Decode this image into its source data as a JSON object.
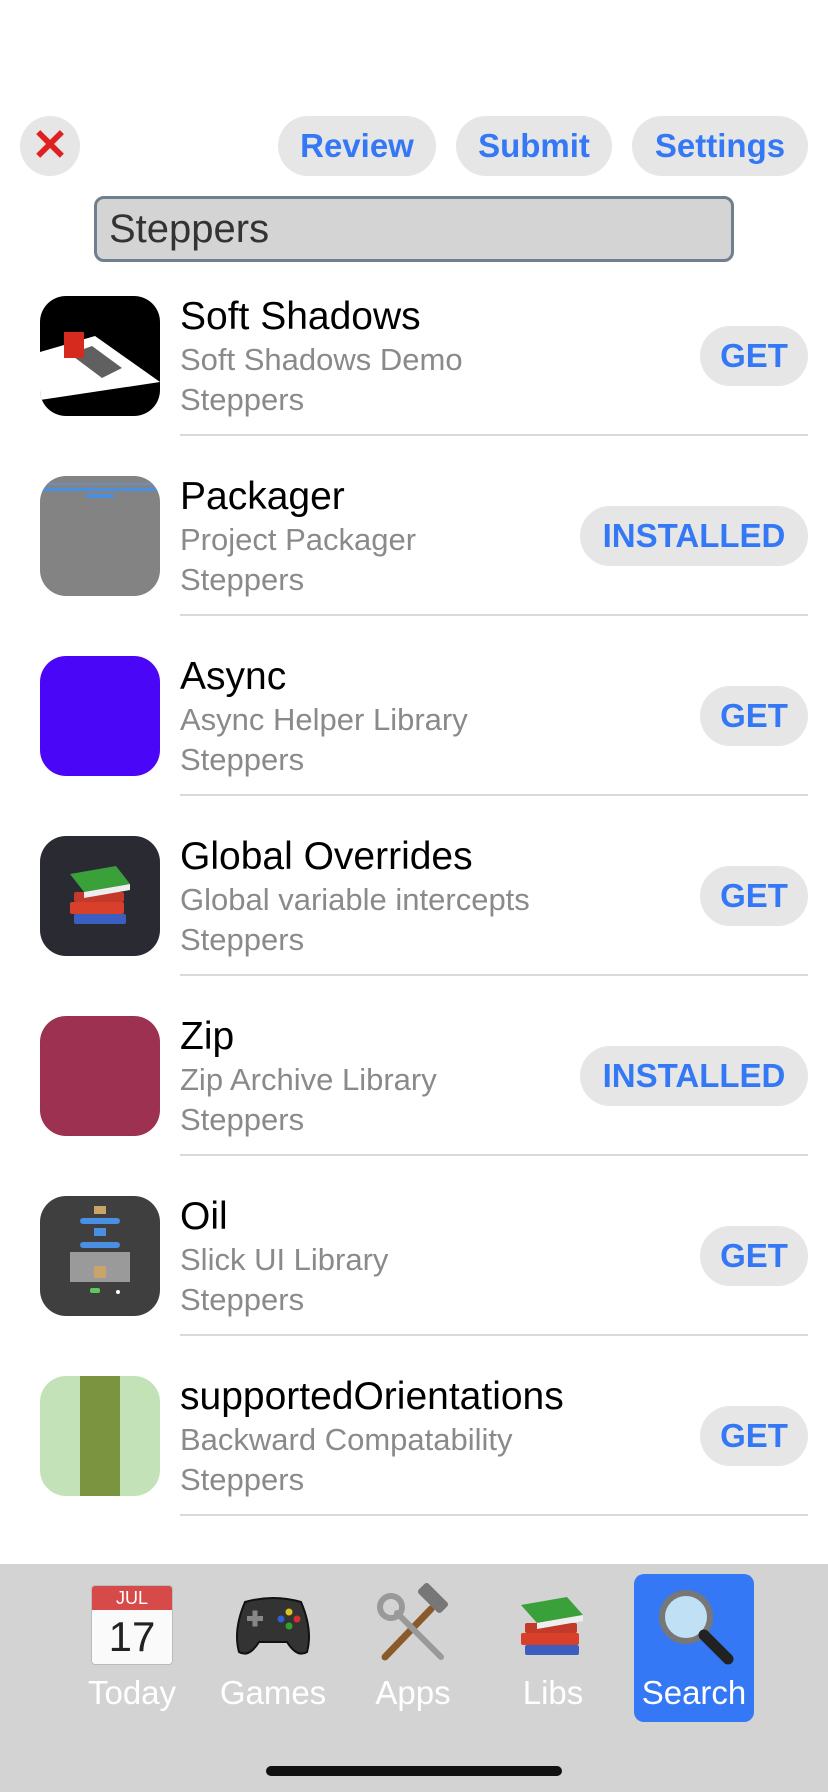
{
  "header": {
    "close_symbol": "✕",
    "review_label": "Review",
    "submit_label": "Submit",
    "settings_label": "Settings"
  },
  "search": {
    "value": "Steppers"
  },
  "apps": [
    {
      "name": "Soft Shadows",
      "description": "Soft Shadows Demo",
      "author": "Steppers",
      "action": "GET"
    },
    {
      "name": "Packager",
      "description": "Project Packager",
      "author": "Steppers",
      "action": "INSTALLED"
    },
    {
      "name": "Async",
      "description": "Async Helper Library",
      "author": "Steppers",
      "action": "GET"
    },
    {
      "name": "Global Overrides",
      "description": "Global variable intercepts",
      "author": "Steppers",
      "action": "GET"
    },
    {
      "name": "Zip",
      "description": "Zip Archive Library",
      "author": "Steppers",
      "action": "INSTALLED"
    },
    {
      "name": "Oil",
      "description": "Slick UI Library",
      "author": "Steppers",
      "action": "GET"
    },
    {
      "name": "supportedOrientations",
      "description": "Backward Compatability",
      "author": "Steppers",
      "action": "GET"
    }
  ],
  "tabbar": {
    "tabs": [
      {
        "label": "Today",
        "icon": "calendar-icon",
        "calendar_month": "JUL",
        "calendar_day": "17"
      },
      {
        "label": "Games",
        "icon": "gamepad-icon"
      },
      {
        "label": "Apps",
        "icon": "tools-icon"
      },
      {
        "label": "Libs",
        "icon": "books-icon"
      },
      {
        "label": "Search",
        "icon": "magnifier-icon",
        "active": true
      }
    ]
  },
  "colors": {
    "accent": "#3478f6",
    "close": "#e02020",
    "pill_bg": "#e6e6e6"
  }
}
